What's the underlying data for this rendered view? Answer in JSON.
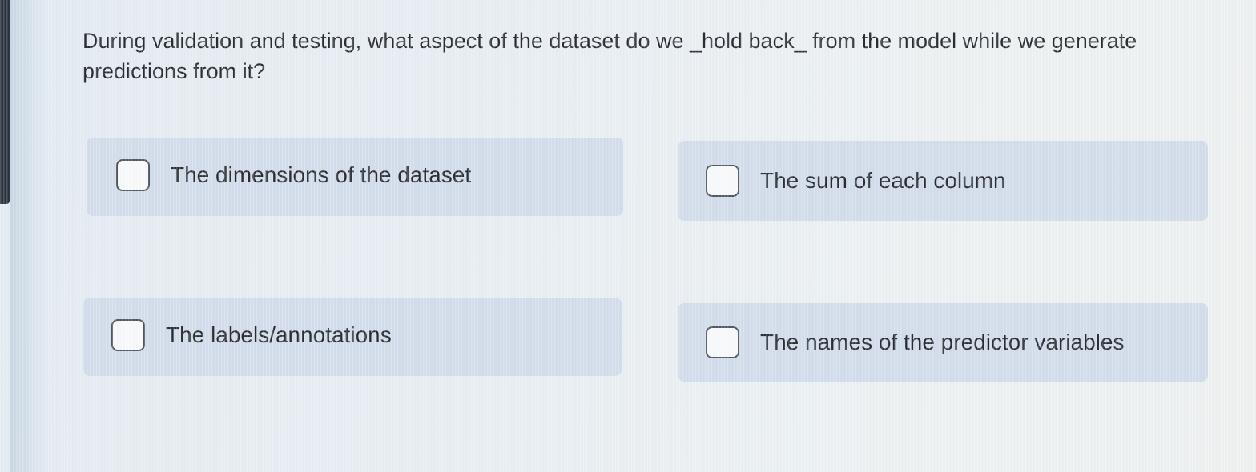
{
  "quiz": {
    "question": "During validation and testing, what aspect of the dataset do we _hold back_ from the model while we generate predictions from it?",
    "options": [
      {
        "label": "The dimensions of the dataset",
        "checked": false
      },
      {
        "label": "The sum of each column",
        "checked": false
      },
      {
        "label": "The labels/annotations",
        "checked": false
      },
      {
        "label": "The names of the predictor variables",
        "checked": false
      }
    ]
  },
  "colors": {
    "option_background": "#d2ddea",
    "page_background": "#e8eef3",
    "text": "#2a2d33",
    "checkbox_border": "#51565e"
  }
}
